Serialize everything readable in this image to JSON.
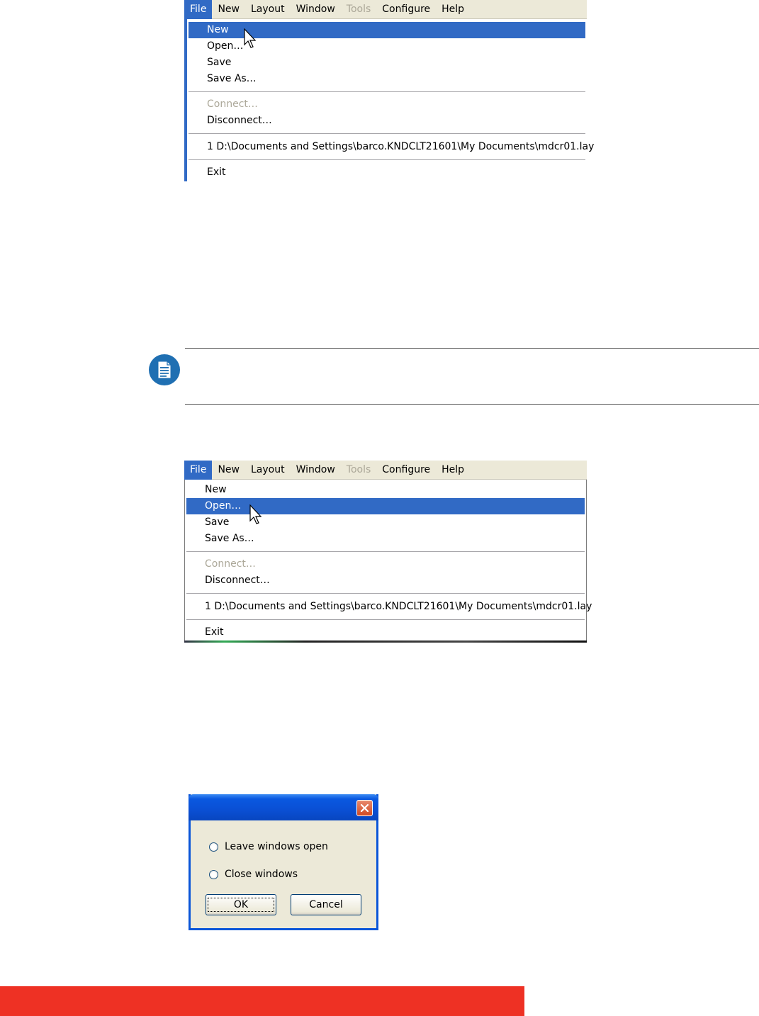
{
  "menubar": {
    "items": [
      {
        "label": "File",
        "state": "active"
      },
      {
        "label": "New",
        "state": "normal"
      },
      {
        "label": "Layout",
        "state": "normal"
      },
      {
        "label": "Window",
        "state": "normal"
      },
      {
        "label": "Tools",
        "state": "disabled"
      },
      {
        "label": "Configure",
        "state": "normal"
      },
      {
        "label": "Help",
        "state": "normal"
      }
    ]
  },
  "file_menu": {
    "new": "New",
    "open": "Open…",
    "save": "Save",
    "save_as": "Save As…",
    "connect": "Connect…",
    "disconnect": "Disconnect…",
    "recent": "1 D:\\Documents and Settings\\barco.KNDCLT21601\\My Documents\\mdcr01.lay",
    "exit": "Exit"
  },
  "screenshot1": {
    "highlighted_item": "New"
  },
  "screenshot2": {
    "highlighted_item": "Open…"
  },
  "dialog": {
    "title": "",
    "option_leave": "Leave windows open",
    "option_close": "Close windows",
    "ok_label": "OK",
    "cancel_label": "Cancel"
  },
  "icons": {
    "note": "note-document-icon",
    "cursor": "arrow-cursor-icon",
    "close": "close-icon"
  },
  "colors": {
    "highlight": "#316ac5",
    "footer": "#ee3124",
    "note_icon": "#1f6fb2"
  }
}
